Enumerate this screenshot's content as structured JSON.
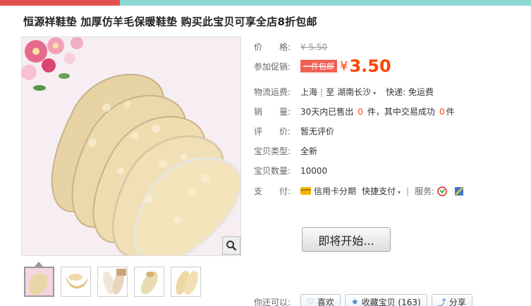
{
  "topbar": {
    "segments": [
      {
        "color": "#e2514b",
        "width": 170
      },
      {
        "color": "#8cd8d2",
        "width": 583
      }
    ]
  },
  "title": "恒源祥鞋垫 加厚仿羊毛保暖鞋垫 购买此宝贝可享全店8折包邮",
  "price": {
    "label": "价　　格:",
    "original": "¥ 5.50"
  },
  "promo": {
    "label": "参加促销:",
    "badge": "一件包邮",
    "yen": "¥",
    "price": "3.50"
  },
  "shipping": {
    "label": "物流运费:",
    "from": "上海",
    "sep": "|",
    "to_prefix": "至",
    "to": "湖南长沙",
    "courier": "快递: 免运费"
  },
  "sales": {
    "label": "销　　量:",
    "text1": "30天内已售出",
    "count1": "0",
    "text2": "件，其中交易成功",
    "count2": "0",
    "text3": "件"
  },
  "rating": {
    "label": "评　　价:",
    "value": "暂无评价"
  },
  "type": {
    "label": "宝贝类型:",
    "value": "全新"
  },
  "quantity": {
    "label": "宝贝数量:",
    "value": "10000"
  },
  "payment": {
    "label": "支　　付:",
    "credit": "信用卡分期",
    "quick": "快捷支付",
    "service_label": "服务:"
  },
  "buy_button": "即将开始...",
  "actions": {
    "label": "你还可以:",
    "like": "喜欢",
    "collect": "收藏宝贝 (163)",
    "share": "分享"
  },
  "colors": {
    "accent": "#ff4400",
    "promo_badge": "#f06055"
  },
  "icons": {
    "zoom": "magnifier-icon",
    "credit": "credit-card-icon",
    "service1": "tmall-guarantee-icon",
    "service2": "quality-icon"
  }
}
